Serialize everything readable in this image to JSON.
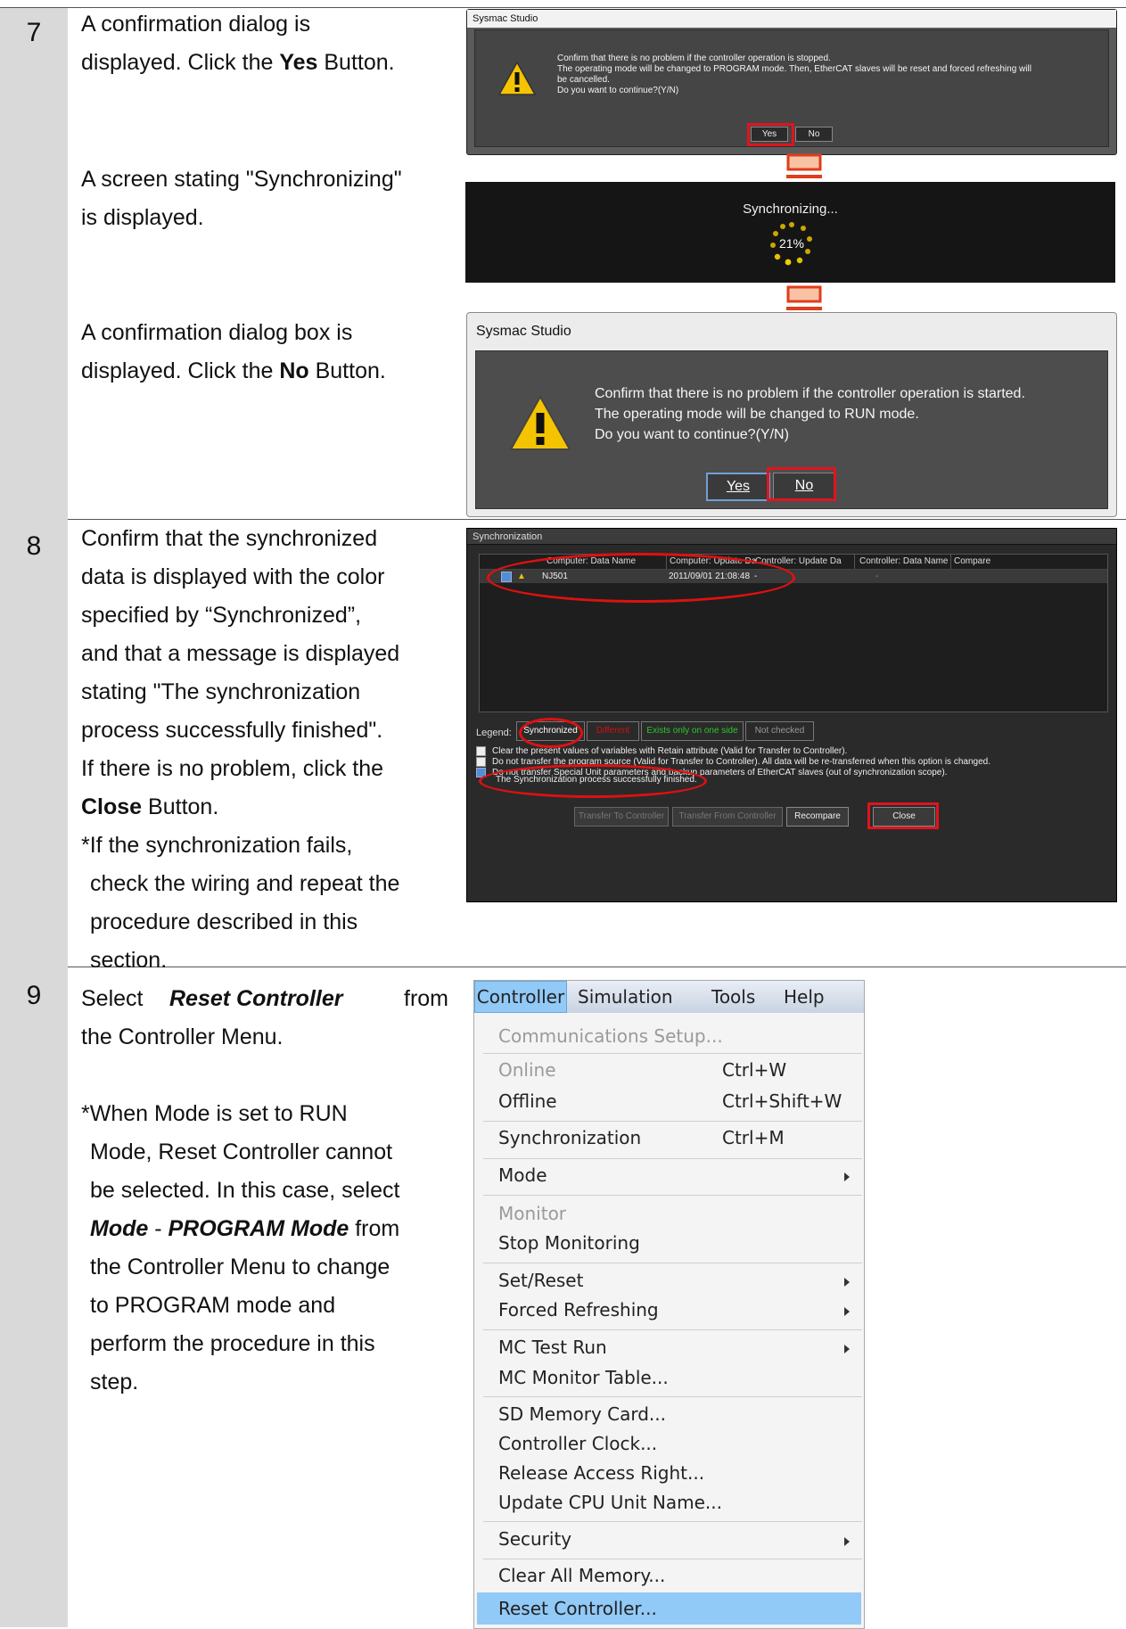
{
  "steps": [
    {
      "num": "7"
    },
    {
      "num": "8"
    },
    {
      "num": "9"
    }
  ],
  "step7": {
    "line1": "A confirmation dialog is",
    "line2a": "displayed. Click the ",
    "line2b": "Yes",
    "line2c": " Button.",
    "sync_line1": "A screen stating \"Synchronizing\"",
    "sync_line2": "is displayed.",
    "conf2_line1": "A confirmation dialog box is",
    "conf2_line2a": "displayed. Click the ",
    "conf2_line2b": "No",
    "conf2_line2c": " Button."
  },
  "dialog1": {
    "title": "Sysmac Studio",
    "msg1": "Confirm that there is no problem if the controller operation is stopped.",
    "msg2": "The operating mode will be changed to PROGRAM mode. Then, EtherCAT slaves will be reset and forced refreshing will",
    "msg3": "be cancelled.",
    "msg4": "Do you want to continue?(Y/N)",
    "yes": "Yes",
    "no": "No"
  },
  "progress": {
    "label": "Synchronizing...",
    "percent": "21%"
  },
  "dialog2": {
    "title": "Sysmac Studio",
    "msg1": "Confirm that there is no problem if the controller operation is started.",
    "msg2": "The operating mode will be changed to RUN mode.",
    "msg3": "Do you want to continue?(Y/N)",
    "yes": "Yes",
    "no": "No"
  },
  "step8": {
    "lines": [
      "Confirm that the synchronized",
      "data is displayed with the color",
      "specified by “Synchronized”,",
      "and that a message is displayed",
      "stating \"The synchronization",
      "process successfully finished\".",
      "If there is no problem, click the"
    ],
    "close_word": "Close",
    "close_rest": " Button.",
    "note": [
      "*If the synchronization fails,",
      "check the wiring and repeat the",
      "procedure described in this",
      "section."
    ]
  },
  "syncwin": {
    "title": "Synchronization",
    "headers": [
      "Computer: Data Name",
      "Computer: Update Da",
      "Controller: Update Da",
      "Controller: Data Name",
      "Compare"
    ],
    "row": {
      "name": "NJ501",
      "date": "2011/09/01 21:08:48",
      "ctrl_date": "-",
      "ctrl_name": "-"
    },
    "legend_label": "Legend:",
    "legend": [
      "Synchronized",
      "Different",
      "Exists only on one side",
      "Not checked"
    ],
    "options": [
      "Clear the present values of variables with Retain attribute (Valid for Transfer to Controller).",
      "Do not transfer the program source (Valid for Transfer to Controller). All data will be re-transferred when this option is changed.",
      "Do not transfer Special Unit parameters and backup parameters of EtherCAT slaves (out of synchronization scope)."
    ],
    "status": "The Synchronization process successfully finished.",
    "buttons": [
      "Transfer To Controller",
      "Transfer From Controller",
      "Recompare",
      "Close"
    ]
  },
  "step9": {
    "select": "Select",
    "reset_ctrl": "Reset Controller",
    "from": "from",
    "line2": "the Controller Menu.",
    "note1": "*When Mode is set to RUN",
    "note2": "Mode, Reset Controller cannot",
    "note3": "be selected. In this case, select",
    "mode": "Mode",
    "dash": " - ",
    "program_mode": "PROGRAM Mode",
    "from2": " from",
    "note5": "the Controller Menu to change",
    "note6": "to PROGRAM mode and",
    "note7": "perform the procedure in this",
    "note8": "step."
  },
  "menu": {
    "bar": [
      "Controller",
      "Simulation",
      "Tools",
      "Help"
    ],
    "items": [
      {
        "label": "Communications Setup...",
        "shortcut": ""
      },
      {
        "label": "Online",
        "shortcut": "Ctrl+W"
      },
      {
        "label": "Offline",
        "shortcut": "Ctrl+Shift+W"
      },
      {
        "label": "Synchronization",
        "shortcut": "Ctrl+M"
      },
      {
        "label": "Mode",
        "shortcut": ""
      },
      {
        "label": "Monitor",
        "shortcut": ""
      },
      {
        "label": "Stop Monitoring",
        "shortcut": ""
      },
      {
        "label": "Set/Reset",
        "shortcut": ""
      },
      {
        "label": "Forced Refreshing",
        "shortcut": ""
      },
      {
        "label": "MC Test Run",
        "shortcut": ""
      },
      {
        "label": "MC Monitor Table...",
        "shortcut": ""
      },
      {
        "label": "SD Memory Card...",
        "shortcut": ""
      },
      {
        "label": "Controller Clock...",
        "shortcut": ""
      },
      {
        "label": "Release Access Right...",
        "shortcut": ""
      },
      {
        "label": "Update CPU Unit Name...",
        "shortcut": ""
      },
      {
        "label": "Security",
        "shortcut": ""
      },
      {
        "label": "Clear All Memory...",
        "shortcut": ""
      },
      {
        "label": "Reset Controller...",
        "shortcut": ""
      }
    ]
  },
  "colors": {
    "highlight_red": "#e0141e",
    "menu_select": "#91c9f7",
    "synchronized": "#ffffff",
    "different": "#ff0000",
    "one_side": "#28c828"
  }
}
